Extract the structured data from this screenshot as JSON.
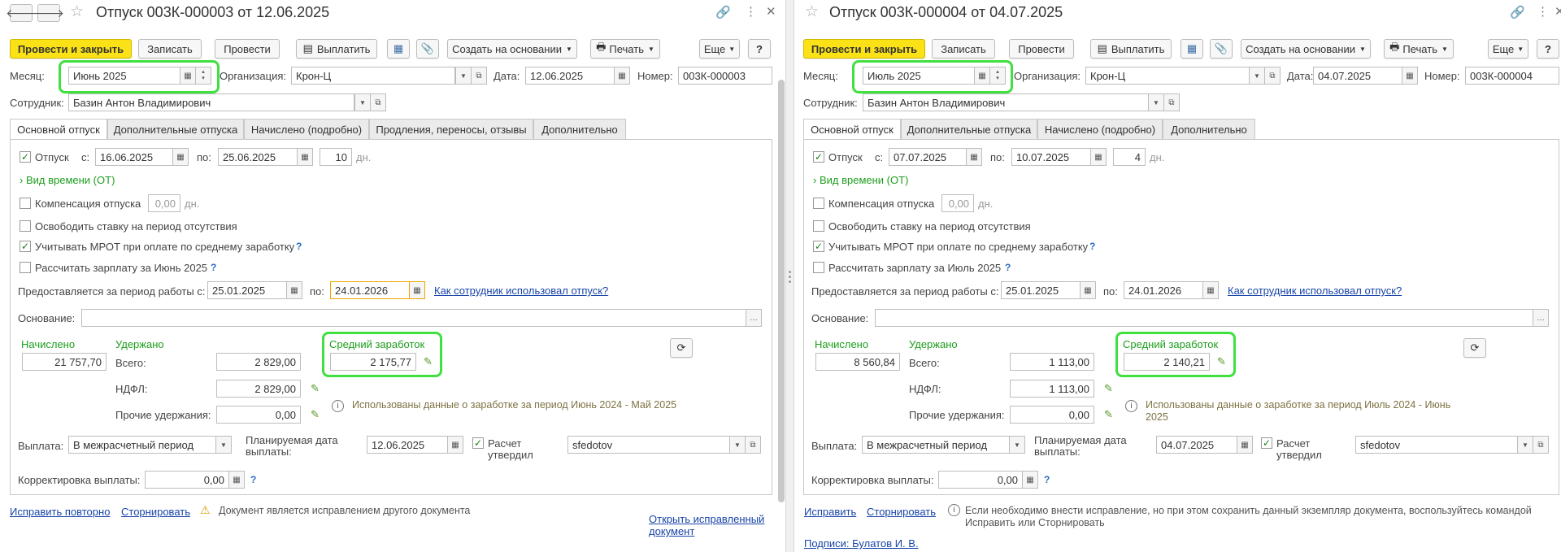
{
  "left": {
    "title": "Отпуск 003К-000003 от 12.06.2025",
    "toolbar": {
      "post_close": "Провести и закрыть",
      "save": "Записать",
      "post": "Провести",
      "pay": "Выплатить",
      "create_based": "Создать на основании",
      "print": "Печать",
      "more": "Еще",
      "help": "?"
    },
    "labels": {
      "month": "Месяц:",
      "org": "Организация:",
      "date": "Дата:",
      "number": "Номер:",
      "employee": "Сотрудник:"
    },
    "month": "Июнь 2025",
    "org": "Крон-Ц",
    "date": "12.06.2025",
    "number": "003К-000003",
    "employee": "Базин Антон Владимирович",
    "tabs": [
      "Основной отпуск",
      "Дополнительные отпуска",
      "Начислено (подробно)",
      "Продления, переносы, отзывы",
      "Дополнительно"
    ],
    "vacation": {
      "label": "Отпуск",
      "from_lbl": "с:",
      "from": "16.06.2025",
      "to_lbl": "по:",
      "to": "25.06.2025",
      "days": "10",
      "days_unit": "дн."
    },
    "time_kind": "Вид времени (ОТ)",
    "compensation": {
      "label": "Компенсация отпуска",
      "value": "0,00",
      "unit": "дн."
    },
    "free_rate": "Освободить ставку на период отсутствия",
    "mrot": "Учитывать МРОТ при оплате по среднему заработку",
    "calc_salary": "Рассчитать зарплату за Июнь 2025",
    "period": {
      "label": "Предоставляется за период работы с:",
      "from": "25.01.2025",
      "to_lbl": "по:",
      "to": "24.01.2026",
      "link": "Как сотрудник использовал отпуск?"
    },
    "basis": "Основание:",
    "accrued": {
      "title": "Начислено",
      "value": "21 757,70"
    },
    "withheld": {
      "title": "Удержано",
      "total_lbl": "Всего:",
      "total": "2 829,00",
      "ndfl_lbl": "НДФЛ:",
      "ndfl": "2 829,00",
      "other_lbl": "Прочие удержания:",
      "other": "0,00"
    },
    "avg": {
      "title": "Средний заработок",
      "value": "2 175,77"
    },
    "info": "Использованы данные о заработке за период Июнь 2024 - Май 2025",
    "payout": {
      "label": "Выплата:",
      "value": "В межрасчетный период",
      "plan_lbl": "Планируемая дата выплаты:",
      "plan": "12.06.2025",
      "approved": "Расчет утвердил",
      "user": "sfedotov"
    },
    "correction": {
      "label": "Корректировка выплаты:",
      "value": "0,00"
    },
    "footer": {
      "fix_again": "Исправить повторно",
      "reverse": "Сторнировать",
      "warning": "Документ является исправлением другого документа",
      "open_fixed": "Открыть исправленный документ"
    }
  },
  "right": {
    "title": "Отпуск 003К-000004 от 04.07.2025",
    "toolbar": {
      "post_close": "Провести и закрыть",
      "save": "Записать",
      "post": "Провести",
      "pay": "Выплатить",
      "create_based": "Создать на основании",
      "print": "Печать",
      "more": "Еще",
      "help": "?"
    },
    "labels": {
      "month": "Месяц:",
      "org": "Организация:",
      "date": "Дата:",
      "number": "Номер:",
      "employee": "Сотрудник:"
    },
    "month": "Июль 2025",
    "org": "Крон-Ц",
    "date": "04.07.2025",
    "number": "003К-000004",
    "employee": "Базин Антон Владимирович",
    "tabs": [
      "Основной отпуск",
      "Дополнительные отпуска",
      "Начислено (подробно)",
      "Дополнительно"
    ],
    "vacation": {
      "label": "Отпуск",
      "from_lbl": "с:",
      "from": "07.07.2025",
      "to_lbl": "по:",
      "to": "10.07.2025",
      "days": "4",
      "days_unit": "дн."
    },
    "time_kind": "Вид времени (ОТ)",
    "compensation": {
      "label": "Компенсация отпуска",
      "value": "0,00",
      "unit": "дн."
    },
    "free_rate": "Освободить ставку на период отсутствия",
    "mrot": "Учитывать МРОТ при оплате по среднему заработку",
    "calc_salary": "Рассчитать зарплату за Июль 2025",
    "period": {
      "label": "Предоставляется за период работы с:",
      "from": "25.01.2025",
      "to_lbl": "по:",
      "to": "24.01.2026",
      "link": "Как сотрудник использовал отпуск?"
    },
    "basis": "Основание:",
    "accrued": {
      "title": "Начислено",
      "value": "8 560,84"
    },
    "withheld": {
      "title": "Удержано",
      "total_lbl": "Всего:",
      "total": "1 113,00",
      "ndfl_lbl": "НДФЛ:",
      "ndfl": "1 113,00",
      "other_lbl": "Прочие удержания:",
      "other": "0,00"
    },
    "avg": {
      "title": "Средний заработок",
      "value": "2 140,21"
    },
    "info": "Использованы данные о заработке за период Июль 2024 - Июнь 2025",
    "payout": {
      "label": "Выплата:",
      "value": "В межрасчетный период",
      "plan_lbl": "Планируемая дата выплаты:",
      "plan": "04.07.2025",
      "approved": "Расчет утвердил",
      "user": "sfedotov"
    },
    "correction": {
      "label": "Корректировка выплаты:",
      "value": "0,00"
    },
    "footer": {
      "fix": "Исправить",
      "reverse": "Сторнировать",
      "info": "Если необходимо внести исправление, но при этом сохранить данный экземпляр документа, воспользуйтесь командой Исправить или Сторнировать",
      "signatures": "Подписи: Булатов И. В."
    }
  },
  "icons": {
    "back": "arrow-left-icon",
    "forward": "arrow-right-icon",
    "favorite": "star-icon",
    "link": "link-icon",
    "menu": "kebab-menu-icon",
    "close": "close-icon",
    "calendar": "calendar-icon",
    "dropdown": "chevron-down-icon",
    "open": "open-form-icon",
    "edit": "pencil-icon",
    "refresh": "refresh-icon"
  },
  "colors": {
    "primary": "#fbe216",
    "accent_green": "#1d9e1d",
    "highlight": "#3fe03f",
    "link": "#1845a8",
    "info_text": "#7d7142"
  }
}
